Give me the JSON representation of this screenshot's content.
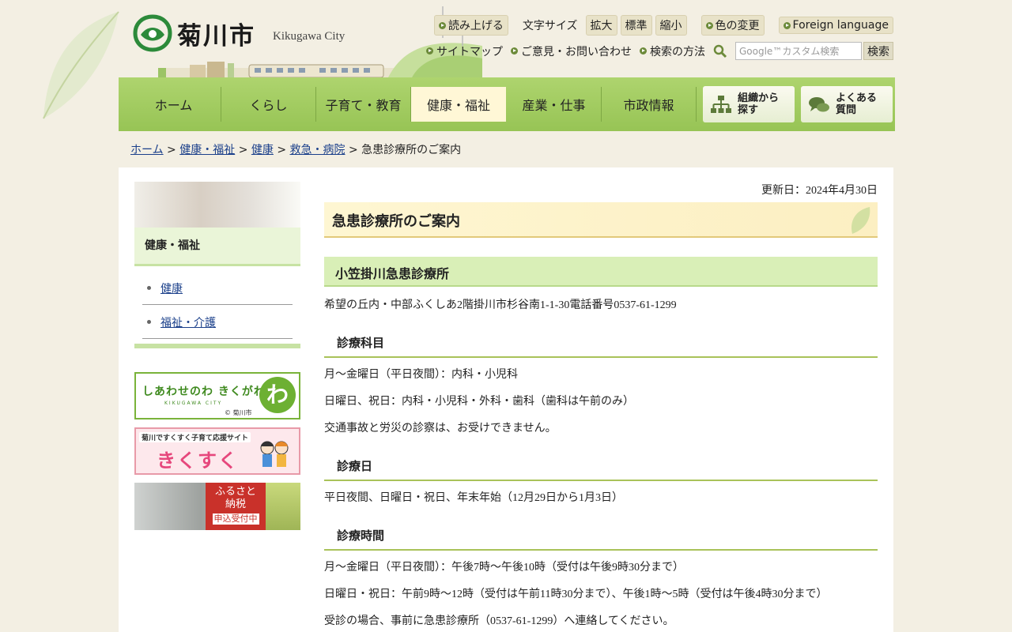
{
  "header": {
    "city_name": "菊川市",
    "city_name_en": "Kikugawa City"
  },
  "utility": {
    "read_aloud": "読み上げる",
    "font_size_label": "文字サイズ",
    "font_larger": "拡大",
    "font_normal": "標準",
    "font_smaller": "縮小",
    "color_change": "色の変更",
    "foreign_language": "Foreign language",
    "sitemap": "サイトマップ",
    "contact": "ご意見・お問い合わせ",
    "search_method": "検索の方法",
    "search_placeholder": "Google™カスタム検索",
    "search_button": "検索"
  },
  "nav": {
    "items": [
      {
        "label": "ホーム"
      },
      {
        "label": "くらし"
      },
      {
        "label": "子育て・教育"
      },
      {
        "label": "健康・福祉"
      },
      {
        "label": "産業・仕事"
      },
      {
        "label": "市政情報"
      }
    ],
    "org_search": "組織から探す",
    "faq": "よくある質問"
  },
  "breadcrumb": {
    "home": "ホーム",
    "l1": "健康・福祉",
    "l2": "健康",
    "l3": "救急・病院",
    "current": "急患診療所のご案内",
    "sep": ">"
  },
  "sidebar": {
    "title": "健康・福祉",
    "items": [
      {
        "label": "健康"
      },
      {
        "label": "福祉・介護"
      }
    ]
  },
  "banners": {
    "b1_title": "しあわせのわ きくがわ",
    "b1_sub": "KIKUGAWA CITY",
    "b1_copy": "© 菊川市",
    "b1_mark": "わ",
    "b2_top": "菊川ですくすく子育て応援サイト",
    "b2_big": "きくすく",
    "b3_line1": "ふるさと",
    "b3_line2": "納税",
    "b3_badge": "申込受付中"
  },
  "main": {
    "updated": "更新日：2024年4月30日",
    "title": "急患診療所のご案内",
    "clinic_name": "小笠掛川急患診療所",
    "address": "希望の丘内・中部ふくしあ2階掛川市杉谷南1-1-30電話番号0537-61-1299",
    "dept_heading": "診療科目",
    "dept_weekday": "月～金曜日（平日夜間）：内科・小児科",
    "dept_holiday": "日曜日、祝日：内科・小児科・外科・歯科（歯科は午前のみ）",
    "dept_note": "交通事故と労災の診察は、お受けできません。",
    "days_heading": "診療日",
    "days_text": "平日夜間、日曜日・祝日、年末年始（12月29日から1月3日）",
    "hours_heading": "診療時間",
    "hours_weekday": "月～金曜日（平日夜間）：午後7時～午後10時（受付は午後9時30分まで）",
    "hours_holiday": "日曜日・祝日：午前9時～12時（受付は午前11時30分まで）、午後1時～5時（受付は午後4時30分まで）",
    "hours_note": "受診の場合、事前に急患診療所（0537-61-1299）へ連絡してください。"
  }
}
